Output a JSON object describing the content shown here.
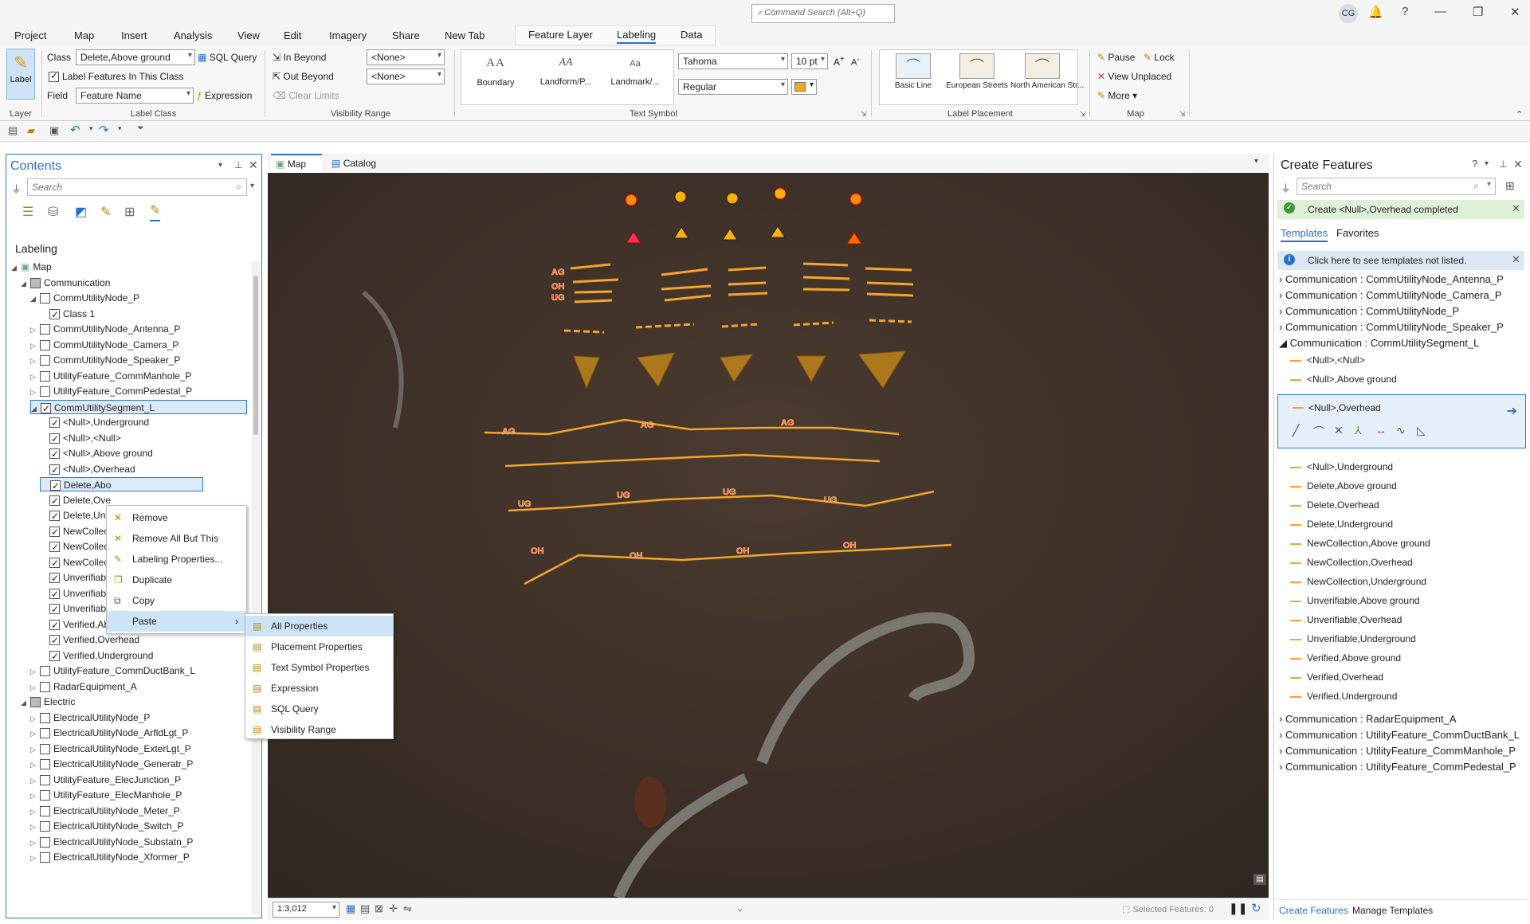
{
  "app": {
    "command_search_placeholder": "Command Search (Alt+Q)",
    "user_initials": "CG"
  },
  "menu": {
    "tabs": [
      "Project",
      "Map",
      "Insert",
      "Analysis",
      "View",
      "Edit",
      "Imagery",
      "Share",
      "New Tab"
    ],
    "context_tabs": [
      "Feature Layer",
      "Labeling",
      "Data"
    ],
    "active_tab": "Labeling"
  },
  "ribbon": {
    "layer_group": {
      "label_button": "Label",
      "group_label": "Layer"
    },
    "label_class": {
      "class_label": "Class",
      "class_value": "Delete,Above ground",
      "sql_query": "SQL Query",
      "label_features": "Label Features In This Class",
      "field_label": "Field",
      "field_value": "Feature Name",
      "expression": "Expression",
      "group_label": "Label Class"
    },
    "visibility": {
      "in_beyond": "In Beyond",
      "out_beyond": "Out Beyond",
      "clear_limits": "Clear Limits",
      "in_value": "<None>",
      "out_value": "<None>",
      "group_label": "Visibility Range"
    },
    "text_symbol": {
      "gallery": [
        "Boundary",
        "Landform/P...",
        "Landmark/..."
      ],
      "font": "Tahoma",
      "size": "10 pt",
      "style": "Regular",
      "color": "#f5a623",
      "group_label": "Text Symbol"
    },
    "label_placement": {
      "gallery": [
        "Basic Line",
        "European Streets",
        "North American Str..."
      ],
      "group_label": "Label Placement"
    },
    "map_group": {
      "pause": "Pause",
      "lock": "Lock",
      "view_unplaced": "View Unplaced",
      "more": "More",
      "group_label": "Map"
    }
  },
  "contents": {
    "title": "Contents",
    "search_placeholder": "Search",
    "section": "Labeling",
    "tree": [
      {
        "label": "Map",
        "level": 0,
        "exp": "◢",
        "check": "map"
      },
      {
        "label": "Communication",
        "level": 1,
        "exp": "◢",
        "check": "group"
      },
      {
        "label": "CommUtilityNode_P",
        "level": 2,
        "exp": "◢",
        "check": "off"
      },
      {
        "label": "Class 1",
        "level": 3,
        "exp": "",
        "check": "on"
      },
      {
        "label": "CommUtilityNode_Antenna_P",
        "level": 2,
        "exp": "▷",
        "check": "off"
      },
      {
        "label": "CommUtilityNode_Camera_P",
        "level": 2,
        "exp": "▷",
        "check": "off"
      },
      {
        "label": "CommUtilityNode_Speaker_P",
        "level": 2,
        "exp": "▷",
        "check": "off"
      },
      {
        "label": "UtilityFeature_CommManhole_P",
        "level": 2,
        "exp": "▷",
        "check": "off"
      },
      {
        "label": "UtilityFeature_CommPedestal_P",
        "level": 2,
        "exp": "▷",
        "check": "off"
      },
      {
        "label": "CommUtilitySegment_L",
        "level": 2,
        "exp": "◢",
        "check": "on",
        "hl": true
      },
      {
        "label": "<Null>,Underground",
        "level": 3,
        "exp": "",
        "check": "on"
      },
      {
        "label": "<Null>,<Null>",
        "level": 3,
        "exp": "",
        "check": "on"
      },
      {
        "label": "<Null>,Above ground",
        "level": 3,
        "exp": "",
        "check": "on"
      },
      {
        "label": "<Null>,Overhead",
        "level": 3,
        "exp": "",
        "check": "on"
      },
      {
        "label": "Delete,Abo",
        "level": 3,
        "exp": "",
        "check": "on",
        "hl": true
      },
      {
        "label": "Delete,Ove",
        "level": 3,
        "exp": "",
        "check": "on"
      },
      {
        "label": "Delete,Und",
        "level": 3,
        "exp": "",
        "check": "on"
      },
      {
        "label": "NewCollec",
        "level": 3,
        "exp": "",
        "check": "on"
      },
      {
        "label": "NewCollec",
        "level": 3,
        "exp": "",
        "check": "on"
      },
      {
        "label": "NewCollec",
        "level": 3,
        "exp": "",
        "check": "on"
      },
      {
        "label": "Unverifiabl",
        "level": 3,
        "exp": "",
        "check": "on"
      },
      {
        "label": "Unverifiabl",
        "level": 3,
        "exp": "",
        "check": "on"
      },
      {
        "label": "Unverifiabl",
        "level": 3,
        "exp": "",
        "check": "on"
      },
      {
        "label": "Verified,Above ground",
        "level": 3,
        "exp": "",
        "check": "on"
      },
      {
        "label": "Verified,Overhead",
        "level": 3,
        "exp": "",
        "check": "on"
      },
      {
        "label": "Verified,Underground",
        "level": 3,
        "exp": "",
        "check": "on"
      },
      {
        "label": "UtilityFeature_CommDuctBank_L",
        "level": 2,
        "exp": "▷",
        "check": "off"
      },
      {
        "label": "RadarEquipment_A",
        "level": 2,
        "exp": "▷",
        "check": "off"
      },
      {
        "label": "Electric",
        "level": 1,
        "exp": "◢",
        "check": "group"
      },
      {
        "label": "ElectricalUtilityNode_P",
        "level": 2,
        "exp": "▷",
        "check": "off"
      },
      {
        "label": "ElectricalUtilityNode_ArfldLgt_P",
        "level": 2,
        "exp": "▷",
        "check": "off"
      },
      {
        "label": "ElectricalUtilityNode_ExterLgt_P",
        "level": 2,
        "exp": "▷",
        "check": "off"
      },
      {
        "label": "ElectricalUtilityNode_Generatr_P",
        "level": 2,
        "exp": "▷",
        "check": "off"
      },
      {
        "label": "UtilityFeature_ElecJunction_P",
        "level": 2,
        "exp": "▷",
        "check": "off"
      },
      {
        "label": "UtilityFeature_ElecManhole_P",
        "level": 2,
        "exp": "▷",
        "check": "off"
      },
      {
        "label": "ElectricalUtilityNode_Meter_P",
        "level": 2,
        "exp": "▷",
        "check": "off"
      },
      {
        "label": "ElectricalUtilityNode_Switch_P",
        "level": 2,
        "exp": "▷",
        "check": "off"
      },
      {
        "label": "ElectricalUtilityNode_Substatn_P",
        "level": 2,
        "exp": "▷",
        "check": "off"
      },
      {
        "label": "ElectricalUtilityNode_Xformer_P",
        "level": 2,
        "exp": "▷",
        "check": "off"
      }
    ]
  },
  "context_menu": {
    "items": [
      "Remove",
      "Remove All But This",
      "Labeling Properties...",
      "Duplicate",
      "Copy",
      "Paste"
    ],
    "submenu": [
      "All Properties",
      "Placement Properties",
      "Text Symbol Properties",
      "Expression",
      "SQL Query",
      "Visibility Range"
    ]
  },
  "map": {
    "tabs": [
      "Map",
      "Catalog"
    ],
    "scale": "1:3,012",
    "selected_features": "Selected Features: 0",
    "line_labels": [
      "AG",
      "OH",
      "UG",
      "AG",
      "AG",
      "AG",
      "UG",
      "UG",
      "UG",
      "UG",
      "OH",
      "OH",
      "OH",
      "OH"
    ]
  },
  "create_features": {
    "title": "Create Features",
    "search_placeholder": "Search",
    "status_message": "Create <Null>,Overhead completed",
    "tabs": [
      "Templates",
      "Favorites"
    ],
    "info_message": "Click here to see templates not listed.",
    "categories_top": [
      "Communication : CommUtilityNode_Antenna_P",
      "Communication : CommUtilityNode_Camera_P",
      "Communication : CommUtilityNode_P",
      "Communication : CommUtilityNode_Speaker_P",
      "Communication : CommUtilitySegment_L"
    ],
    "templates_before": [
      "<Null>,<Null>",
      "<Null>,Above ground"
    ],
    "active_template": "<Null>,Overhead",
    "templates_after": [
      "<Null>,Underground",
      "Delete,Above ground",
      "Delete,Overhead",
      "Delete,Underground",
      "NewCollection,Above ground",
      "NewCollection,Overhead",
      "NewCollection,Underground",
      "Unverifiable,Above ground",
      "Unverifiable,Overhead",
      "Unverifiable,Underground",
      "Verified,Above ground",
      "Verified,Overhead",
      "Verified,Underground"
    ],
    "categories_bottom": [
      "Communication : RadarEquipment_A",
      "Communication : UtilityFeature_CommDuctBank_L",
      "Communication : UtilityFeature_CommManhole_P",
      "Communication : UtilityFeature_CommPedestal_P"
    ],
    "bottom_tabs": [
      "Create Features",
      "Manage Templates"
    ]
  }
}
